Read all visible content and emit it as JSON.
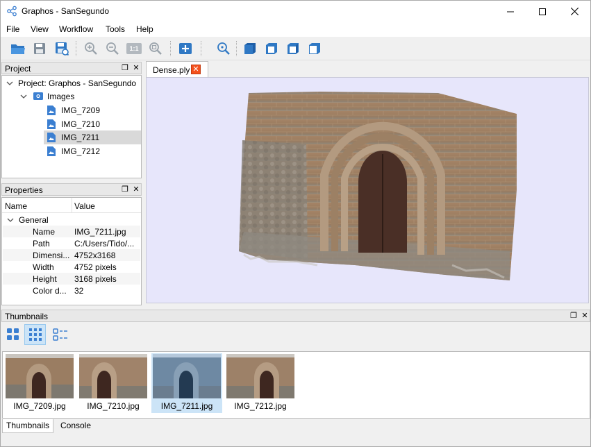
{
  "window": {
    "title": "Graphos - SanSegundo"
  },
  "menu": [
    "File",
    "View",
    "Workflow",
    "Tools",
    "Help"
  ],
  "toolbar": {
    "buttons": [
      "open-project",
      "save-project",
      "save-project-as",
      "zoom-in",
      "zoom-out",
      "zoom-1to1",
      "zoom-extend",
      "add-images",
      "zoom-3d",
      "front-view",
      "top-view",
      "left-view",
      "right-view"
    ],
    "zoom_1to1_label": "1:1"
  },
  "project_panel": {
    "title": "Project",
    "root": "Project: Graphos - SanSegundo",
    "images_label": "Images",
    "images": [
      "IMG_7209",
      "IMG_7210",
      "IMG_7211",
      "IMG_7212"
    ],
    "selected": "IMG_7211"
  },
  "properties_panel": {
    "title": "Properties",
    "col_name": "Name",
    "col_value": "Value",
    "group": "General",
    "rows": [
      {
        "name": "Name",
        "value": "IMG_7211.jpg"
      },
      {
        "name": "Path",
        "value": "C:/Users/Tido/..."
      },
      {
        "name": "Dimensi...",
        "value": "4752x3168"
      },
      {
        "name": "Width",
        "value": "4752 pixels"
      },
      {
        "name": "Height",
        "value": "3168 pixels"
      },
      {
        "name": "Color d...",
        "value": "32"
      }
    ]
  },
  "viewer": {
    "tab_label": "Dense.ply",
    "background": "#e7e6fb"
  },
  "thumbnails_panel": {
    "title": "Thumbnails",
    "items": [
      "IMG_7209.jpg",
      "IMG_7210.jpg",
      "IMG_7211.jpg",
      "IMG_7212.jpg"
    ],
    "selected": "IMG_7211.jpg"
  },
  "bottom_tabs": [
    "Thumbnails",
    "Console"
  ],
  "colors": {
    "accent": "#3b7fd1",
    "selection": "#cce4f7",
    "close_tab": "#f4511e"
  }
}
